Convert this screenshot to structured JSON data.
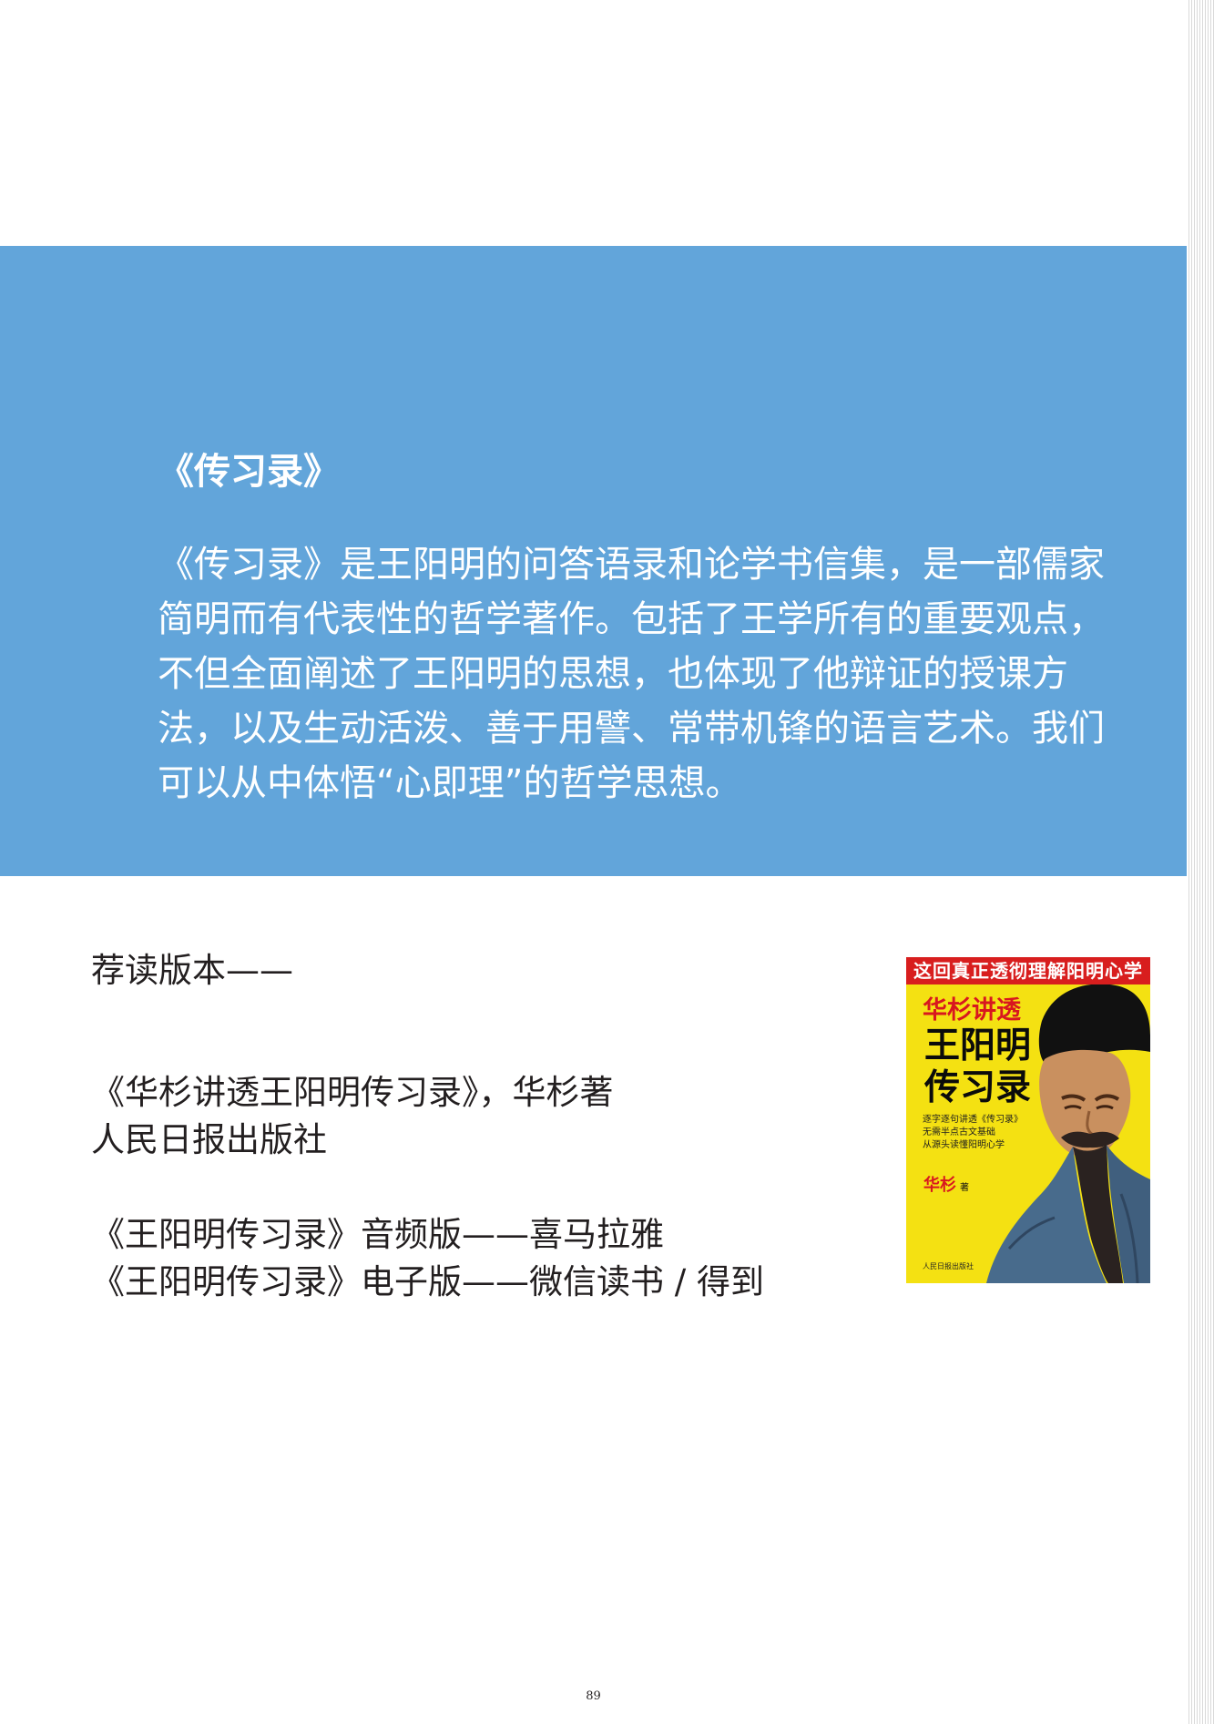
{
  "section": {
    "title": "《传习录》",
    "body": "《传习录》是王阳明的问答语录和论学书信集，是一部儒家简明而有代表性的哲学著作。包括了王学所有的重要观点，不但全面阐述了王阳明的思想，也体现了他辩证的授课方法，以及生动活泼、善于用譬、常带机锋的语言艺术。我们可以从中体悟“心即理”的哲学思想。"
  },
  "recommendations": {
    "heading": "荐读版本——",
    "entries": [
      "《华杉讲透王阳明传习录》，华杉著",
      "人民日报出版社",
      "《王阳明传习录》音频版——喜马拉雅",
      "《王阳明传习录》电子版——微信读书 / 得到"
    ]
  },
  "book_cover": {
    "banner": "这回真正透彻理解阳明心学",
    "author_line": "华杉讲透",
    "title_line_1": "王阳明",
    "title_line_2": "传习录",
    "subtitle_lines": [
      "逐字逐句讲透《传习录》",
      "无需半点古文基础",
      "从源头读懂阳明心学"
    ],
    "author": "华杉",
    "author_suffix": "著",
    "publisher": "人民日报出版社",
    "colors": {
      "background": "#f4e112",
      "banner": "#d81e1e",
      "accent": "#d8171f"
    }
  },
  "page_number": "89",
  "colors": {
    "panel": "#62a5da",
    "body_text": "#231f20",
    "panel_text": "#ffffff"
  }
}
